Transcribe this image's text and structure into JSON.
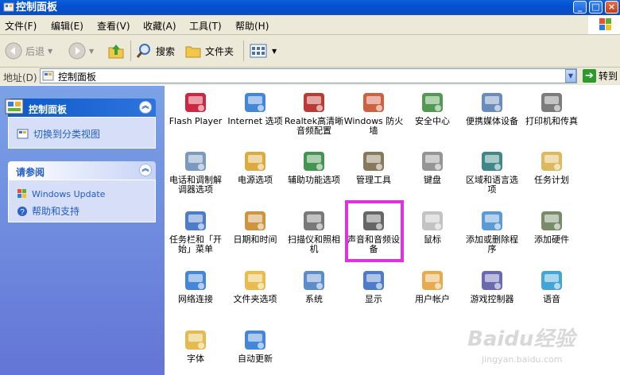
{
  "window": {
    "title": "控制面板"
  },
  "menu": [
    "文件(F)",
    "编辑(E)",
    "查看(V)",
    "收藏(A)",
    "工具(T)",
    "帮助(H)"
  ],
  "toolbar": {
    "back": "后退",
    "search": "搜索",
    "folders": "文件夹"
  },
  "address": {
    "label": "地址(D)",
    "value": "控制面板",
    "go": "转到"
  },
  "sidebar": {
    "panel_title": "控制面板",
    "switch_view": "切换到分类视图",
    "see_also_title": "请参阅",
    "links": [
      "Windows Update",
      "帮助和支持"
    ]
  },
  "items": [
    {
      "label": "Flash Player",
      "icon": "flash-icon"
    },
    {
      "label": "Internet 选项",
      "icon": "internet-options-icon"
    },
    {
      "label": "Realtek高清晰音频配置",
      "icon": "realtek-audio-icon"
    },
    {
      "label": "Windows 防火墙",
      "icon": "firewall-icon"
    },
    {
      "label": "安全中心",
      "icon": "security-center-icon"
    },
    {
      "label": "便携媒体设备",
      "icon": "portable-media-icon"
    },
    {
      "label": "打印机和传真",
      "icon": "printer-icon"
    },
    {
      "label": "电话和调制解调器选项",
      "icon": "phone-modem-icon"
    },
    {
      "label": "电源选项",
      "icon": "power-options-icon"
    },
    {
      "label": "辅助功能选项",
      "icon": "accessibility-icon"
    },
    {
      "label": "管理工具",
      "icon": "admin-tools-icon"
    },
    {
      "label": "键盘",
      "icon": "keyboard-icon"
    },
    {
      "label": "区域和语言选项",
      "icon": "region-language-icon"
    },
    {
      "label": "任务计划",
      "icon": "scheduled-tasks-icon"
    },
    {
      "label": "任务栏和「开始」菜单",
      "icon": "taskbar-start-icon"
    },
    {
      "label": "日期和时间",
      "icon": "date-time-icon"
    },
    {
      "label": "扫描仪和照相机",
      "icon": "scanner-camera-icon"
    },
    {
      "label": "声音和音频设备",
      "icon": "sound-audio-icon"
    },
    {
      "label": "鼠标",
      "icon": "mouse-icon"
    },
    {
      "label": "添加或删除程序",
      "icon": "add-remove-programs-icon"
    },
    {
      "label": "添加硬件",
      "icon": "add-hardware-icon"
    },
    {
      "label": "网络连接",
      "icon": "network-connections-icon"
    },
    {
      "label": "文件夹选项",
      "icon": "folder-options-icon"
    },
    {
      "label": "系统",
      "icon": "system-icon"
    },
    {
      "label": "显示",
      "icon": "display-icon"
    },
    {
      "label": "用户帐户",
      "icon": "user-accounts-icon"
    },
    {
      "label": "游戏控制器",
      "icon": "game-controller-icon"
    },
    {
      "label": "语音",
      "icon": "speech-icon"
    },
    {
      "label": "字体",
      "icon": "fonts-icon"
    },
    {
      "label": "自动更新",
      "icon": "automatic-updates-icon"
    }
  ],
  "highlight_color": "#e030e0",
  "watermark": {
    "main": "Baidu经验",
    "sub": "jingyan.baidu.com"
  }
}
